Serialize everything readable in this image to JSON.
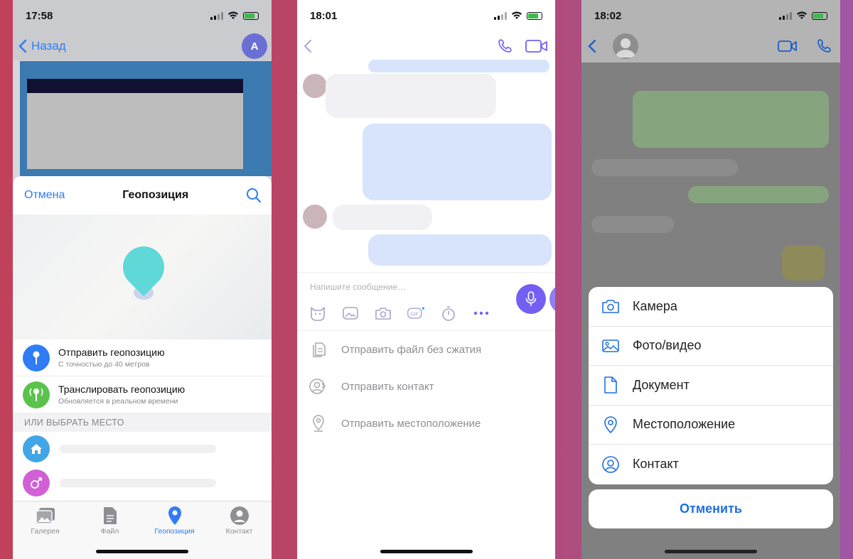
{
  "phone1": {
    "time": "17:58",
    "back_label": "Назад",
    "avatar_letter": "A",
    "sheet": {
      "cancel": "Отмена",
      "title": "Геопозиция"
    },
    "send_location": {
      "title": "Отправить геопозицию",
      "subtitle": "С точностью до 40 метров",
      "color": "#2f7cf6"
    },
    "live_location": {
      "title": "Транслировать геопозицию",
      "subtitle": "Обновляется в реальном времени",
      "color": "#59c34b"
    },
    "section_label": "ИЛИ ВЫБРАТЬ МЕСТО",
    "places": [
      {
        "icon": "home-icon",
        "color": "#42a5e6"
      },
      {
        "icon": "gender-icon",
        "color": "#d160d6"
      }
    ],
    "tabs": [
      {
        "label": "Галерея",
        "icon": "gallery-icon"
      },
      {
        "label": "Файл",
        "icon": "file-icon"
      },
      {
        "label": "Геопозиция",
        "icon": "location-pin-icon",
        "active": true
      },
      {
        "label": "Контакт",
        "icon": "contact-icon"
      }
    ]
  },
  "phone2": {
    "time": "18:01",
    "composer_placeholder": "Напишите сообщение…",
    "gif_label": "GIF",
    "menu": [
      {
        "label": "Отправить файл без сжатия",
        "icon": "file-copy-icon"
      },
      {
        "label": "Отправить контакт",
        "icon": "contact-share-icon"
      },
      {
        "label": "Отправить местоположение",
        "icon": "location-pin-icon"
      }
    ],
    "accent": "#7360f2"
  },
  "phone3": {
    "time": "18:02",
    "sheet": [
      {
        "label": "Камера",
        "icon": "camera-icon"
      },
      {
        "label": "Фото/видео",
        "icon": "photo-icon"
      },
      {
        "label": "Документ",
        "icon": "document-icon"
      },
      {
        "label": "Местоположение",
        "icon": "location-pin-icon"
      },
      {
        "label": "Контакт",
        "icon": "contact-icon"
      }
    ],
    "cancel_label": "Отменить",
    "accent": "#1f6fe0"
  }
}
